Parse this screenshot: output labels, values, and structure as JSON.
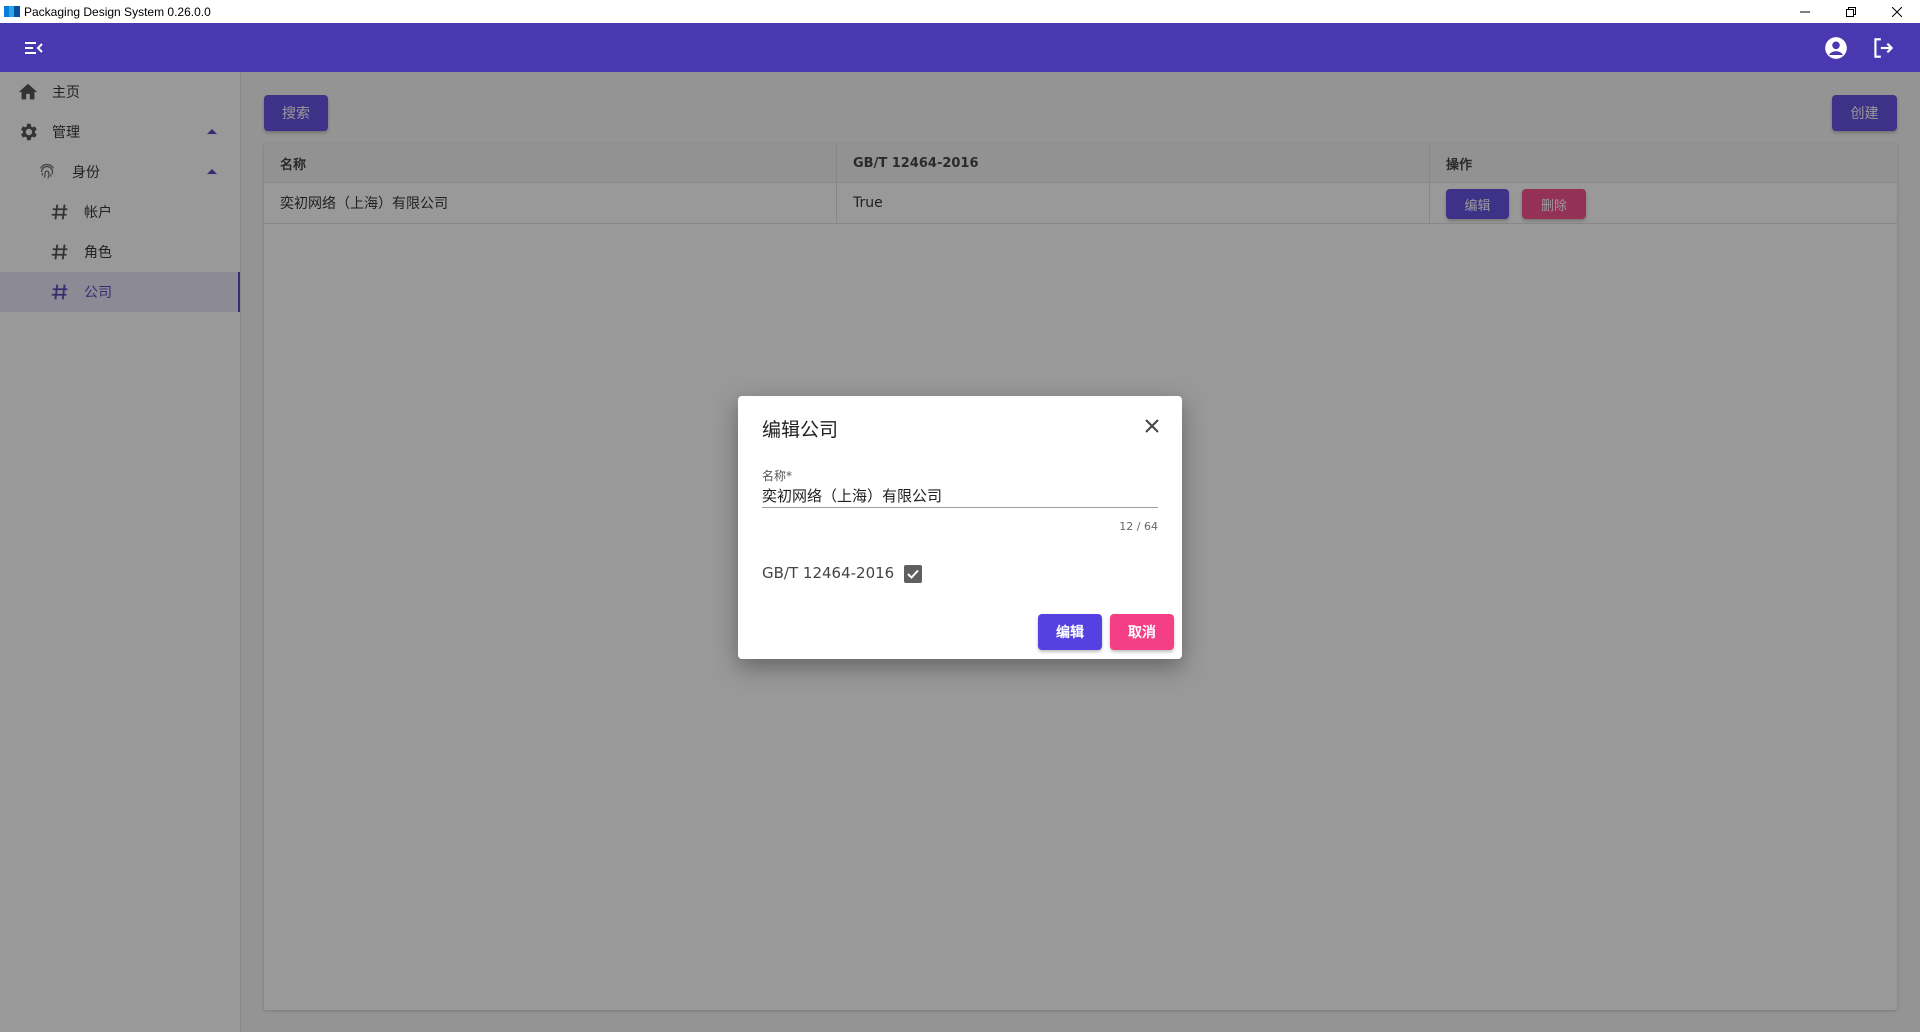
{
  "window": {
    "title": "Packaging Design System 0.26.0.0",
    "controls": [
      "minimize-icon",
      "restore-icon",
      "close-icon"
    ]
  },
  "appbar": {
    "menu_icon": "menu-collapse-icon",
    "account_icon": "account-circle-icon",
    "logout_icon": "logout-icon",
    "color": "#4a38b0"
  },
  "sidebar": {
    "items": [
      {
        "label": "主页",
        "icon": "home-icon"
      },
      {
        "label": "管理",
        "icon": "gear-icon",
        "expanded": true
      },
      {
        "label": "身份",
        "icon": "fingerprint-icon",
        "expanded": true
      },
      {
        "label": "帐户",
        "icon": "hash-icon"
      },
      {
        "label": "角色",
        "icon": "hash-icon"
      },
      {
        "label": "公司",
        "icon": "hash-icon",
        "active": true
      }
    ]
  },
  "toolbar": {
    "search_label": "搜索",
    "create_label": "创建"
  },
  "table": {
    "columns": [
      "名称",
      "GB/T 12464-2016",
      "操作"
    ],
    "rows": [
      {
        "name": "奕初网络（上海）有限公司",
        "gbt": "True",
        "edit_label": "编辑",
        "delete_label": "删除"
      }
    ]
  },
  "dialog": {
    "title": "编辑公司",
    "name_label": "名称*",
    "name_value": "奕初网络（上海）有限公司",
    "counter": "12 / 64",
    "checkbox_label": "GB/T 12464-2016",
    "checkbox_checked": true,
    "confirm_label": "编辑",
    "cancel_label": "取消"
  },
  "colors": {
    "primary": "#5540e0",
    "danger": "#f43f86",
    "appbar": "#4a38b0"
  }
}
